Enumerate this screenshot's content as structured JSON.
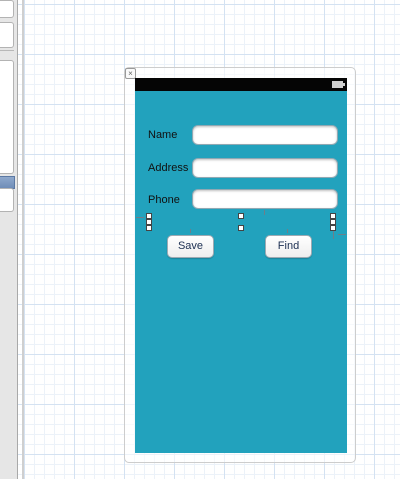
{
  "form": {
    "name_label": "Name",
    "address_label": "Address",
    "phone_label": "Phone",
    "name_value": "",
    "address_value": "",
    "phone_value": ""
  },
  "buttons": {
    "save_label": "Save",
    "find_label": "Find"
  },
  "colors": {
    "screen_background": "#22a2bd",
    "status_bar": "#050505",
    "button_text": "#1c2f52"
  },
  "icons": {
    "close": "close-icon",
    "battery": "battery-icon"
  }
}
